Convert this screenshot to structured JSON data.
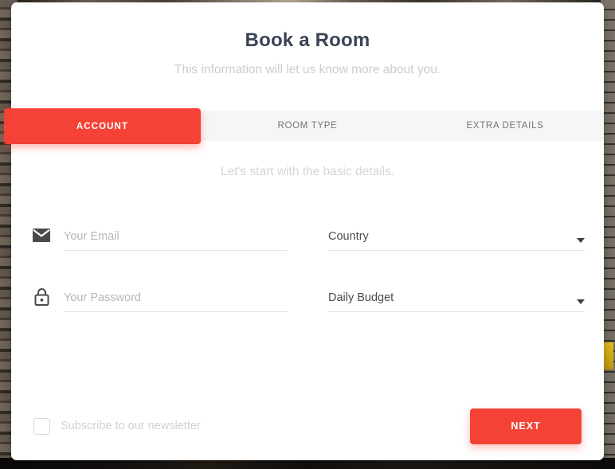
{
  "header": {
    "title": "Book a Room",
    "subtitle": "This information will let us know more about you."
  },
  "tabs": {
    "items": [
      {
        "label": "ACCOUNT",
        "active": true
      },
      {
        "label": "ROOM TYPE",
        "active": false
      },
      {
        "label": "EXTRA DETAILS",
        "active": false
      }
    ]
  },
  "step": {
    "hint": "Let's start with the basic details."
  },
  "form": {
    "email": {
      "placeholder": "Your Email",
      "value": "",
      "icon": "envelope-icon"
    },
    "password": {
      "placeholder": "Your Password",
      "value": "",
      "icon": "lock-icon"
    },
    "country": {
      "placeholder": "Country",
      "value": "Country",
      "caret": "chevron-down-icon"
    },
    "budget": {
      "placeholder": "Daily Budget",
      "value": "Daily Budget",
      "caret": "chevron-down-icon"
    }
  },
  "footer": {
    "newsletter_label": "Subscribe to our newsletter",
    "newsletter_checked": false,
    "next_label": "NEXT"
  },
  "colors": {
    "accent": "#f44336",
    "title": "#3b4355",
    "muted_text": "#c9cdd2",
    "tab_band": "#f6f6f6",
    "card": "#ffffff",
    "underline": "#e2e2e2"
  }
}
